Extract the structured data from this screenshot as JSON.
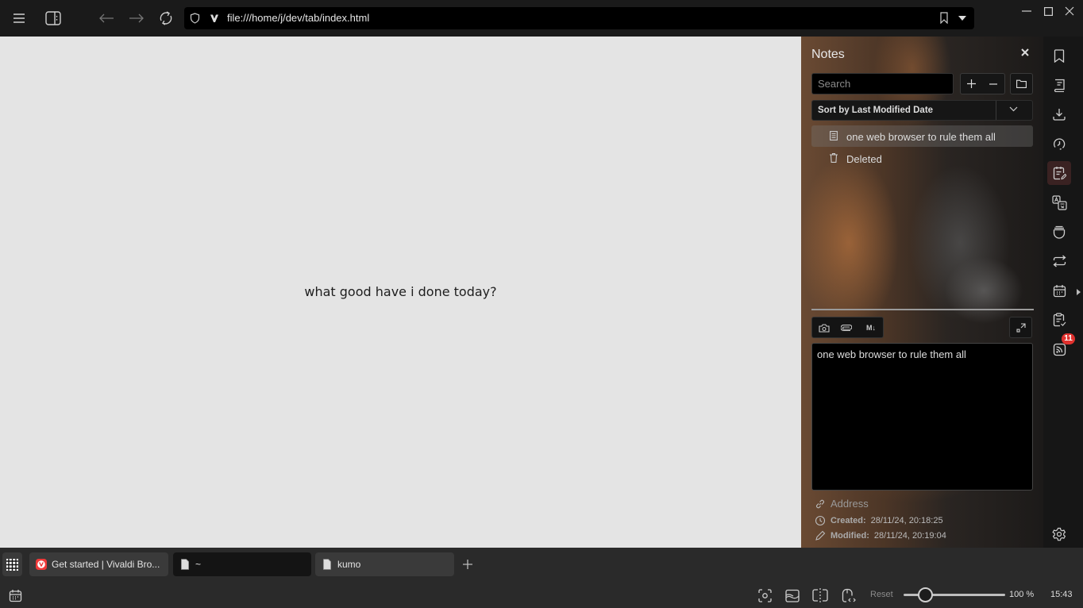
{
  "toolbar": {
    "url": "file:///home/j/dev/tab/index.html",
    "icons": {
      "menu": "menu-icon",
      "panel_toggle": "panel-toggle-icon",
      "back": "arrow-left-icon",
      "forward": "arrow-right-icon",
      "reload": "reload-icon",
      "security": "shield-icon",
      "vivaldi": "vivaldi-icon",
      "bookmark": "bookmark-icon",
      "dropdown": "caret-down-icon"
    }
  },
  "window_controls": {
    "minimize": "minimize-icon",
    "maximize": "maximize-icon",
    "close": "close-icon"
  },
  "content": {
    "text": "what good have i done today?",
    "background": "#e4e4e4"
  },
  "notes_panel": {
    "title": "Notes",
    "search_placeholder": "Search",
    "sort_label": "Sort by Last Modified Date",
    "items": [
      {
        "label": "one web browser to rule them all",
        "icon": "note-icon",
        "selected": true
      },
      {
        "label": "Deleted",
        "icon": "trash-icon",
        "selected": false
      }
    ],
    "editor_text": "one web browser to rule them all",
    "markdown_label": "M↓",
    "address_placeholder": "Address",
    "created_label": "Created:",
    "created_value": "28/11/24, 20:18:25",
    "modified_label": "Modified:",
    "modified_value": "28/11/24, 20:19:04"
  },
  "panel_bar": {
    "items": [
      {
        "name": "bookmarks",
        "icon": "bookmark-icon"
      },
      {
        "name": "reading-list",
        "icon": "book-icon"
      },
      {
        "name": "downloads",
        "icon": "download-icon"
      },
      {
        "name": "history",
        "icon": "history-icon"
      },
      {
        "name": "notes",
        "icon": "notes-icon",
        "active": true
      },
      {
        "name": "translate",
        "icon": "translate-icon"
      },
      {
        "name": "window",
        "icon": "window-icon"
      },
      {
        "name": "sync",
        "icon": "sync-icon"
      },
      {
        "name": "calendar",
        "icon": "calendar-icon"
      },
      {
        "name": "tasks",
        "icon": "tasks-icon"
      },
      {
        "name": "feeds",
        "icon": "rss-icon",
        "badge": "11"
      }
    ],
    "settings_icon": "gear-icon",
    "accent": "#e0312e"
  },
  "tabs": [
    {
      "title": "Get started | Vivaldi Bro...",
      "favicon": "vivaldi-favicon",
      "active": false
    },
    {
      "title": "~",
      "favicon": "file-icon",
      "active": true
    },
    {
      "title": "kumo",
      "favicon": "file-icon",
      "active": false
    }
  ],
  "statusbar": {
    "reset_label": "Reset",
    "zoom_percent": 100,
    "zoom_label": "100 %",
    "clock": "15:43"
  }
}
